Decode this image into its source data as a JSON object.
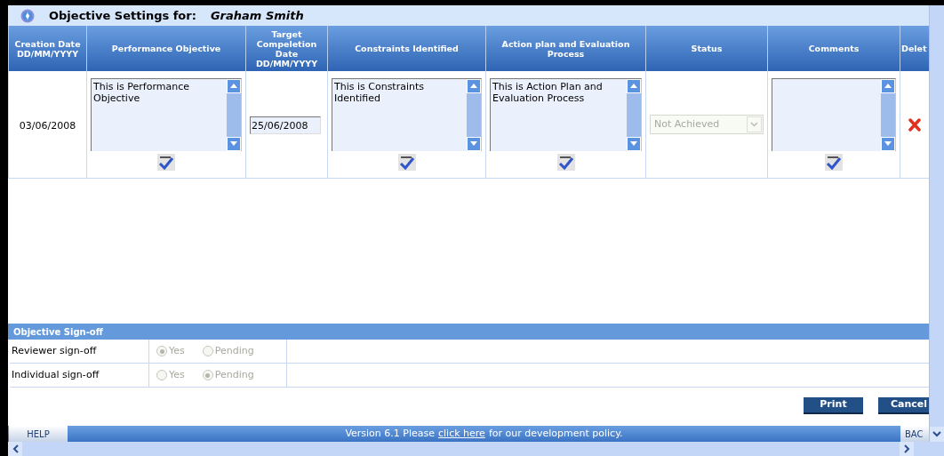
{
  "window": {
    "title": "Objective Settings for:",
    "person": "Graham Smith"
  },
  "table": {
    "columns": [
      "Creation Date DD/MM/YYYY",
      "Performance Objective",
      "Target Compeletion Date DD/MM/YYYY",
      "Constraints Identified",
      "Action plan and Evaluation Process",
      "Status",
      "Comments",
      "Delet"
    ],
    "rows": [
      {
        "creation_date": "03/06/2008",
        "performance_objective": "This is Performance Objective",
        "target_date": "25/06/2008",
        "constraints": "This is Constraints Identified",
        "action_plan": "This is Action Plan and Evaluation Process",
        "status": {
          "value": "Not Achieved",
          "disabled": true
        }
      }
    ]
  },
  "signoff": {
    "title": "Objective Sign-off",
    "rows": [
      {
        "label": "Reviewer sign-off",
        "disabled": true,
        "options": [
          {
            "label": "Yes",
            "selected": true
          },
          {
            "label": "Pending",
            "selected": false
          }
        ]
      },
      {
        "label": "Individual sign-off",
        "disabled": true,
        "options": [
          {
            "label": "Yes",
            "selected": false
          },
          {
            "label": "Pending",
            "selected": true
          }
        ]
      }
    ]
  },
  "buttons": [
    "Print",
    "Cancel"
  ],
  "footer": {
    "help": "HELP",
    "before": "Version 6.1  Please",
    "link": "click here",
    "after": "for our development policy.",
    "back": "BAC"
  }
}
